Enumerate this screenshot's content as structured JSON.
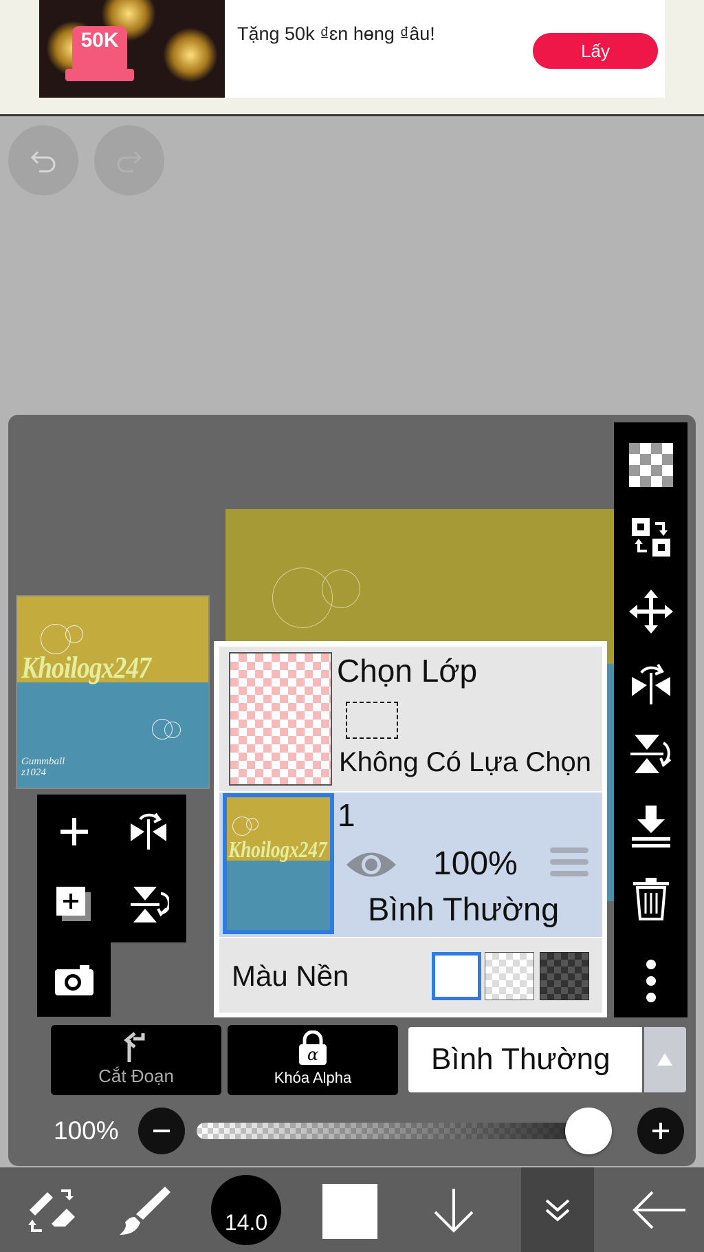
{
  "ad": {
    "badge": "50K",
    "text": "Tặng 50k ₫ɛn hɵng ₫âu!",
    "button_label": "Lấy"
  },
  "layer_panel": {
    "selection": {
      "title": "Chọn Lớp",
      "status": "Không Có Lựa Chọn"
    },
    "layer": {
      "name": "1",
      "opacity": "100%",
      "blend_mode": "Bình Thường",
      "visible": true,
      "selected": true
    },
    "background": {
      "label": "Màu Nền",
      "options": [
        "white",
        "transparent",
        "dark"
      ],
      "selected": "white"
    },
    "thumbnail": {
      "title": "Khoilogx247",
      "signature_line1": "Gummball",
      "signature_line2": "z1024"
    },
    "clipping_label": "Cắt Đoạn",
    "alpha_lock_label": "Khóa Alpha",
    "blend_select_value": "Bình Thường",
    "opacity_label": "100%",
    "opacity_value": 1.0
  },
  "bottom_toolbar": {
    "brush_size": "14.0",
    "current_color": "#ffffff"
  },
  "colors": {
    "accent_blue": "#2f7be2",
    "ad_red": "#ee1747",
    "canvas_yellow": "#a59a35",
    "canvas_blue": "#4c8fa8"
  },
  "icons": {
    "side_toolbar": [
      "checker-icon",
      "layer-swap-icon",
      "move-icon",
      "flip-horizontal-icon",
      "flip-vertical-icon",
      "merge-down-icon",
      "trash-icon",
      "more-vertical-icon"
    ],
    "left_tools": [
      "add-layer-icon",
      "flip-horizontal-icon",
      "add-layer-copy-icon",
      "flip-vertical-icon",
      "camera-icon"
    ],
    "bottom": [
      "tool-switch-icon",
      "brush-icon",
      "brush-size",
      "color-swatch",
      "download-icon",
      "layers-icon",
      "back-icon"
    ]
  }
}
